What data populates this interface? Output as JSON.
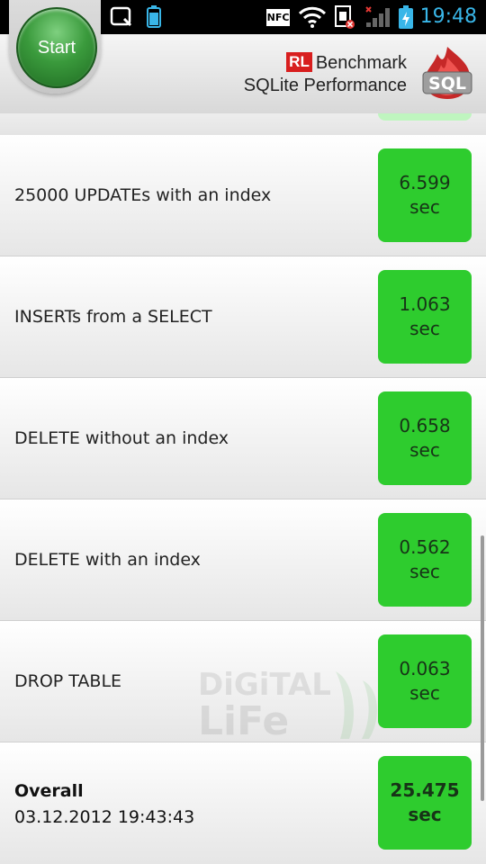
{
  "statusbar": {
    "time": "19:48",
    "nfc": "NFC"
  },
  "header": {
    "start_label": "Start",
    "brand_rl": "RL",
    "brand_name": "Benchmark",
    "brand_sub": "SQLite Performance",
    "logo_text": "SQL"
  },
  "rows": [
    {
      "label": "25000 UPDATEs with an index",
      "value": "6.599",
      "unit": "sec"
    },
    {
      "label": "INSERTs from a SELECT",
      "value": "1.063",
      "unit": "sec"
    },
    {
      "label": "DELETE without an index",
      "value": "0.658",
      "unit": "sec"
    },
    {
      "label": "DELETE with an index",
      "value": "0.562",
      "unit": "sec"
    },
    {
      "label": "DROP TABLE",
      "value": "0.063",
      "unit": "sec"
    }
  ],
  "overall": {
    "title": "Overall",
    "date": "03.12.2012 19:43:43",
    "value": "25.475",
    "unit": "sec"
  },
  "watermark": {
    "line1": "DiGiTAL",
    "line2": "LiFe"
  },
  "colors": {
    "result_green": "#2ecc2e",
    "brand_red": "#d81e1e",
    "time_blue": "#39b6e8"
  }
}
